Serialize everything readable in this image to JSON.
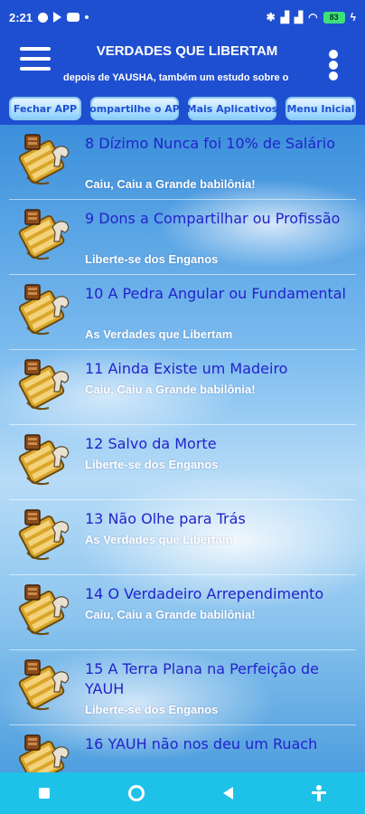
{
  "status": {
    "time": "2:21",
    "battery": "83"
  },
  "header": {
    "title": "VERDADES QUE LIBERTAM",
    "subtitle": "depois de YAUSHA, também um estudo sobre o"
  },
  "toolbar": {
    "buttons": [
      "Fechar APP",
      "Compartilhe o APP",
      "Mais Aplicativos",
      "Menu Inicial"
    ]
  },
  "items": [
    {
      "title": "8 Dízimo Nunca foi 10% de Salário",
      "subtitle": "Caiu, Caiu a Grande babilônia!"
    },
    {
      "title": "9 Dons a Compartilhar ou Profissão",
      "subtitle": "Liberte-se dos Enganos"
    },
    {
      "title": "10 A Pedra Angular ou Fundamental",
      "subtitle": "As Verdades que Libertam"
    },
    {
      "title": "11 Ainda Existe um Madeiro",
      "subtitle": "Caiu, Caiu a Grande babilônia!"
    },
    {
      "title": "12 Salvo da Morte",
      "subtitle": "Liberte-se dos Enganos"
    },
    {
      "title": "13 Não Olhe para Trás",
      "subtitle": "As Verdades que Libertam"
    },
    {
      "title": "14 O Verdadeiro Arrependimento",
      "subtitle": "Caiu, Caiu a Grande babilônia!"
    },
    {
      "title": "15 A Terra Plana na Perfeição de YAUH",
      "subtitle": "Liberte-se dos Enganos"
    },
    {
      "title": "16 YAUH não nos deu um Ruach",
      "subtitle": ""
    }
  ],
  "colors": {
    "appbar": "#1f4fd1",
    "title_text": "#2222cc",
    "navbar": "#1ec2e8"
  },
  "icons": {
    "item": "scroll-horse-icon",
    "menu": "hamburger-icon",
    "more": "kebab-icon"
  }
}
